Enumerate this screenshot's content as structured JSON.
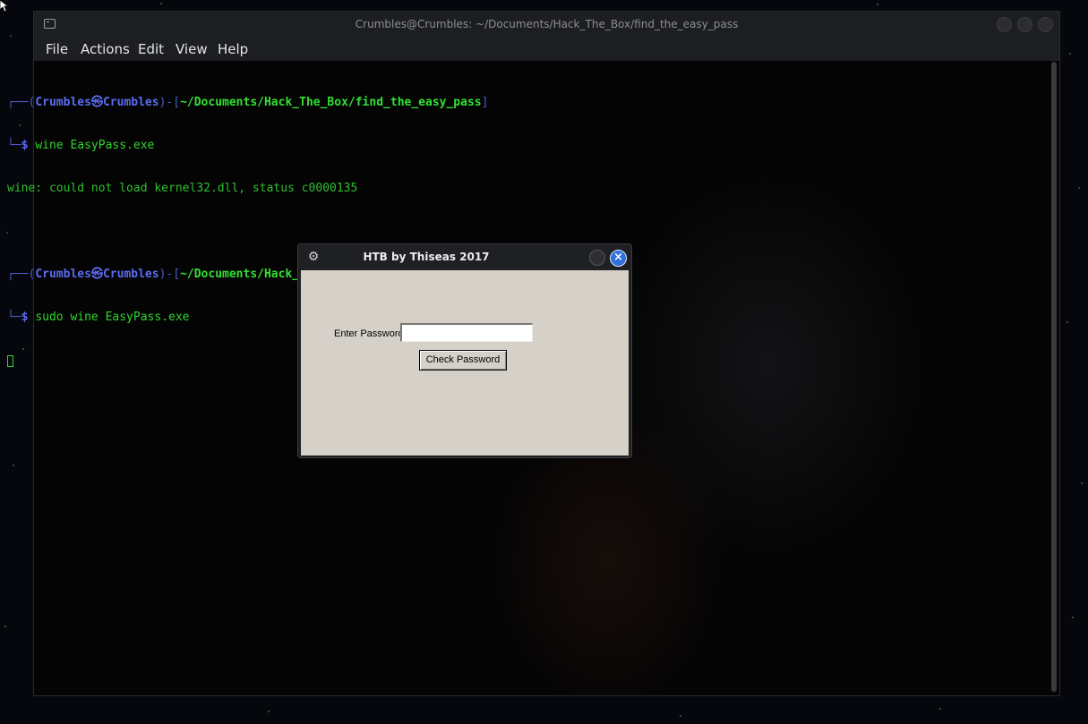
{
  "terminal": {
    "title": "Crumbles@Crumbles: ~/Documents/Hack_The_Box/find_the_easy_pass",
    "menu": [
      "File",
      "Actions",
      "Edit",
      "View",
      "Help"
    ],
    "prompt_user": "Crumbles",
    "prompt_host": "Crumbles",
    "prompt_path": "~/Documents/Hack_The_Box/find_the_easy_pass",
    "commands": [
      {
        "cmd": "wine EasyPass.exe",
        "output": "wine: could not load kernel32.dll, status c0000135"
      },
      {
        "cmd": "sudo wine EasyPass.exe",
        "output": ""
      }
    ]
  },
  "dialog": {
    "title": "HTB by Thiseas 2017",
    "label": "Enter Password",
    "input_value": "",
    "button_label": "Check Password"
  },
  "colors": {
    "prompt_user": "#5a6cf0",
    "prompt_path": "#32e032",
    "close_button": "#2f6fde",
    "dialog_body": "#d5d0c8"
  }
}
